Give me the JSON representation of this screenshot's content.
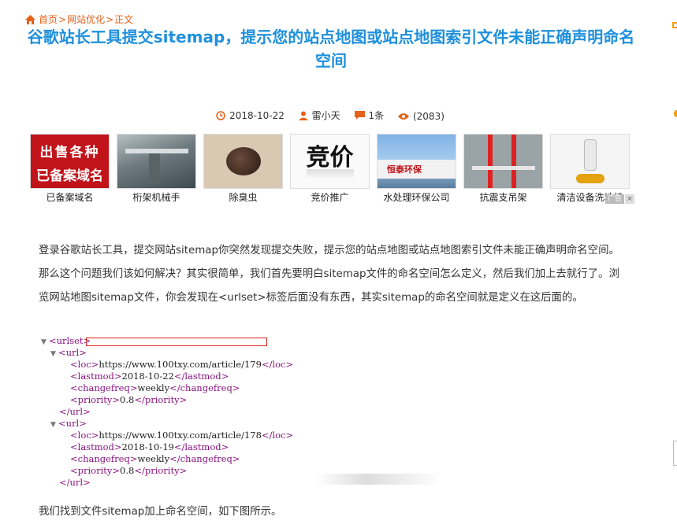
{
  "breadcrumb": {
    "home": "首页",
    "sep1": ">",
    "category": "网站优化",
    "sep2": ">",
    "current": "正文"
  },
  "article": {
    "title": "谷歌站长工具提交sitemap，提示您的站点地图或站点地图索引文件未能正确声明命名空间",
    "date": "2018-10-22",
    "author": "雷小天",
    "comments": "1条",
    "views": "(2083)"
  },
  "ads": {
    "items": [
      {
        "caption": "已备案域名",
        "thumb_text1": "出售各种",
        "thumb_text2": "已备案域名"
      },
      {
        "caption": "桁架机械手"
      },
      {
        "caption": "除臭虫"
      },
      {
        "caption": "竞价推广",
        "thumb_text1": "竞价"
      },
      {
        "caption": "水处理环保公司",
        "thumb_text1": "恒泰环保"
      },
      {
        "caption": "抗震支吊架"
      },
      {
        "caption": "清洁设备洗地机"
      }
    ],
    "close_label": "广告",
    "close_x": "×"
  },
  "content": {
    "paragraph1": "登录谷歌站长工具，提交网站sitemap你突然发现提交失败，提示您的站点地图或站点地图索引文件未能正确声明命名空间。那么这个问题我们该如何解决？其实很简单，我们首先要明白sitemap文件的命名空间怎么定义，然后我们加上去就行了。浏览网站地图sitemap文件，你会发现在<urlset>标签后面没有东西，其实sitemap的命名空间就是定义在这后面的。",
    "paragraph2": "我们找到文件sitemap加上命名空间，如下图所示。"
  },
  "code": {
    "urlset_open": "<urlset>",
    "url_open": "<url>",
    "url_close": "</url>",
    "entries": [
      {
        "loc": "https://www.100txy.com/article/179",
        "lastmod": "2018-10-22",
        "changefreq": "weekly",
        "priority": "0.8"
      },
      {
        "loc": "https://www.100txy.com/article/178",
        "lastmod": "2018-10-19",
        "changefreq": "weekly",
        "priority": "0.8"
      }
    ]
  },
  "colors": {
    "accent": "#e6621a",
    "title": "#1e90dc",
    "tag": "#881280",
    "highlight_box": "#e02020"
  }
}
